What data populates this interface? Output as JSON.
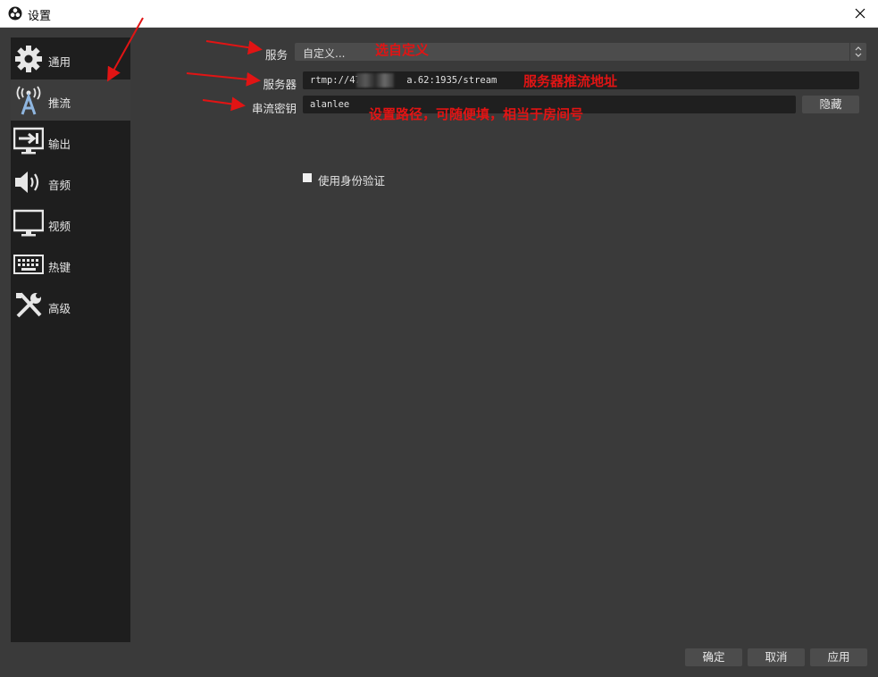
{
  "window": {
    "title": "设置"
  },
  "sidebar": {
    "items": [
      {
        "label": "通用",
        "icon": "gear-icon"
      },
      {
        "label": "推流",
        "icon": "broadcast-tower-icon"
      },
      {
        "label": "输出",
        "icon": "output-monitor-icon"
      },
      {
        "label": "音频",
        "icon": "speaker-icon"
      },
      {
        "label": "视频",
        "icon": "monitor-icon"
      },
      {
        "label": "热键",
        "icon": "keyboard-icon"
      },
      {
        "label": "高级",
        "icon": "tools-icon"
      }
    ],
    "active_index": 1
  },
  "stream": {
    "service_label": "服务",
    "service_value": "自定义...",
    "server_label": "服务器",
    "server_value_prefix": "rtmp://47.",
    "server_value_suffix": "a.62:1935/stream",
    "key_label": "串流密钥",
    "key_value": "alanlee",
    "hide_button": "隐藏",
    "auth_checkbox_label": "使用身份验证",
    "auth_checked": false
  },
  "annotations": {
    "service_note": "选自定义",
    "server_note": "服务器推流地址",
    "key_note": "设置路径，可随便填，相当于房间号"
  },
  "footer": {
    "ok": "确定",
    "cancel": "取消",
    "apply": "应用"
  },
  "colors": {
    "background": "#3a3a3a",
    "sidebar": "#1e1e1e",
    "input": "#1f1f1f",
    "button": "#4c4c4c",
    "annotation": "#e11414"
  }
}
